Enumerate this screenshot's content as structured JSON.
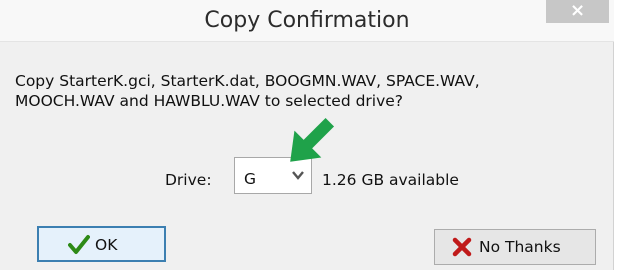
{
  "dialog": {
    "title": "Copy Confirmation",
    "close_glyph": "×",
    "message_line1": "Copy StarterK.gci, StarterK.dat, BOOGMN.WAV, SPACE.WAV,",
    "message_line2": "MOOCH.WAV and HAWBLU.WAV to selected drive?",
    "drive": {
      "label": "Drive:",
      "selected": "G",
      "available_text": "1.26 GB available"
    },
    "buttons": {
      "ok_label": "OK",
      "no_label": "No Thanks"
    }
  },
  "colors": {
    "ok_check": "#2d8a16",
    "no_x": "#c01a1a",
    "annotation_arrow": "#1fa24a",
    "ok_border": "#3c7fb1"
  },
  "icons": [
    "close-icon",
    "chevron-down-icon",
    "checkmark-icon",
    "x-icon",
    "arrow-annotation-icon"
  ]
}
